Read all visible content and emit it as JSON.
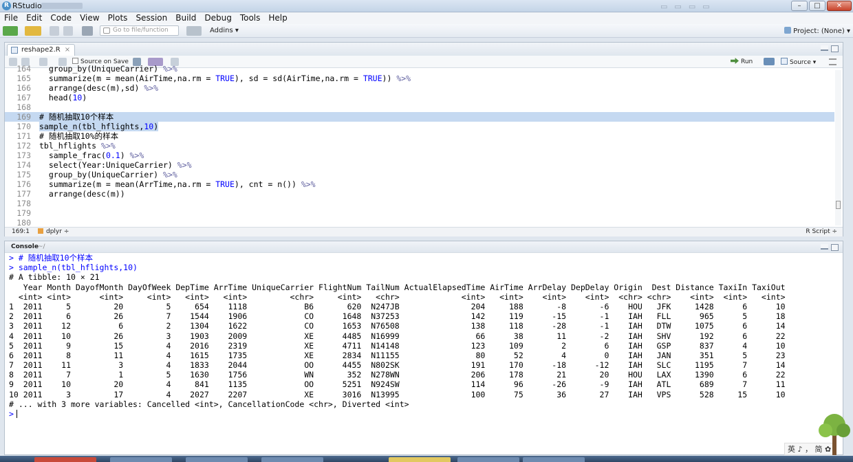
{
  "window": {
    "title": "RStudio"
  },
  "menu": [
    "File",
    "Edit",
    "Code",
    "View",
    "Plots",
    "Session",
    "Build",
    "Debug",
    "Tools",
    "Help"
  ],
  "toolbar": {
    "goto_placeholder": "Go to file/function",
    "addins_label": "Addins ▾",
    "project_label": "Project: (None) ▾"
  },
  "editor": {
    "tab_name": "reshape2.R",
    "source_on_save_label": "Source on Save",
    "run_label": "Run",
    "source_label": "Source ▾",
    "status": {
      "cursor": "169:1",
      "scope": "dplyr ÷",
      "filetype": "R Script ÷"
    }
  },
  "console": {
    "title": "Console",
    "path": "~/",
    "lines": [
      "> # 随机抽取10个样本",
      "> sample_n(tbl_hflights,10)",
      "# A tibble: 10 × 21",
      "   Year Month DayofMonth DayOfWeek DepTime ArrTime UniqueCarrier FlightNum TailNum ActualElapsedTime AirTime ArrDelay DepDelay Origin  Dest Distance TaxiIn TaxiOut",
      "  <int> <int>      <int>     <int>   <int>   <int>         <chr>     <int>   <chr>             <int>   <int>    <int>    <int>  <chr> <chr>    <int>  <int>   <int>",
      "1  2011     5         20         5     654    1118            B6       620  N247JB               204     188       -8       -6    HOU   JFK     1428      6      10",
      "2  2011     6         26         7    1544    1906            CO      1648  N37253               142     119      -15       -1    IAH   FLL      965      5      18",
      "3  2011    12          6         2    1304    1622            CO      1653  N76508               138     118      -28       -1    IAH   DTW     1075      6      14",
      "4  2011    10         26         3    1903    2009            XE      4485  N16999                66      38       11       -2    IAH   SHV      192      6      22",
      "5  2011     9         15         4    2016    2319            XE      4711  N14148               123     109        2        6    IAH   GSP      837      4      10",
      "6  2011     8         11         4    1615    1735            XE      2834  N11155                80      52        4        0    IAH   JAN      351      5      23",
      "7  2011    11          3         4    1833    2044            OO      4455  N802SK               191     170      -18      -12    IAH   SLC     1195      7      14",
      "8  2011     7          1         5    1630    1756            WN       352  N278WN               206     178       21       20    HOU   LAX     1390      6      22",
      "9  2011    10         20         4     841    1135            OO      5251  N924SW               114      96      -26       -9    IAH   ATL      689      7      11",
      "10 2011     3         17         4    2027    2207            XE      3016  N13995               100      75       36       27    IAH   VPS      528     15      10",
      "# ... with 3 more variables: Cancelled <int>, CancellationCode <chr>, Diverted <int>"
    ],
    "prompt": ">"
  },
  "ime": {
    "label": "英 ♪ ， 简 ✿"
  }
}
